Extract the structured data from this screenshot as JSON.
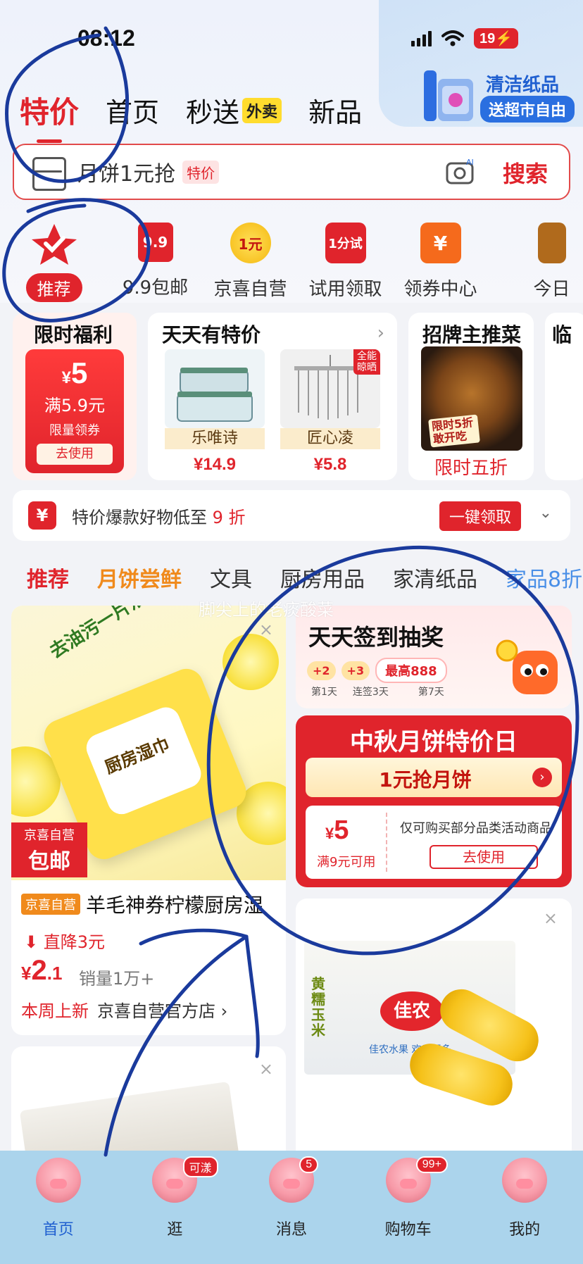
{
  "status_bar": {
    "time": "08:12",
    "battery": "19"
  },
  "promo_corner": {
    "line1": "清洁纸品",
    "line2": "送超市自由"
  },
  "top_tabs": [
    {
      "label": "特价",
      "active": true
    },
    {
      "label": "首页"
    },
    {
      "label": "秒送",
      "badge": "外卖"
    },
    {
      "label": "新品"
    }
  ],
  "search": {
    "query": "月饼1元抢",
    "tag": "特价",
    "button": "搜索"
  },
  "categories": [
    {
      "label": "推荐",
      "active": true,
      "icon": "star-check-icon"
    },
    {
      "label": "9.9包邮",
      "icon": "tag-99-icon",
      "text": "9.9"
    },
    {
      "label": "京喜自营",
      "icon": "coin-1yuan-icon",
      "text": "1元"
    },
    {
      "label": "试用领取",
      "icon": "gift-bag-icon",
      "text": "1分试"
    },
    {
      "label": "领券中心",
      "icon": "coupon-icon",
      "text": "¥"
    },
    {
      "label": "今日",
      "icon": "partial-icon"
    }
  ],
  "cards": {
    "limited": {
      "title": "限时福利",
      "amount": "5",
      "condition": "满5.9元",
      "note": "限量领券",
      "use": "去使用"
    },
    "daily": {
      "title": "天天有特价",
      "products": [
        {
          "name": "乐唯诗",
          "price": "¥14.9"
        },
        {
          "name": "匠心凌",
          "price": "¥5.8",
          "tag": "全能晾晒"
        }
      ]
    },
    "signature": {
      "title": "招牌主推菜",
      "tag": "限时5折 敢开吃",
      "subtitle": "限时五折"
    },
    "partial": {
      "title": "临"
    }
  },
  "coupon_strip": {
    "text": "特价爆款好物低至",
    "highlight": "9 折",
    "button": "一键领取"
  },
  "feed_tabs": [
    "推荐",
    "月饼尝鲜",
    "文具",
    "厨房用品",
    "家清纸品",
    "家品8折"
  ],
  "watermark": "脚尖上的老痰酸菜",
  "feed_left": {
    "slogan": "去油污一片洁净",
    "pack_brand": "厨房湿巾",
    "badge_top": "京喜自营",
    "badge_bottom": "包邮",
    "tag": "京喜自营",
    "title": "羊毛神券柠檬厨房湿",
    "drop": "直降3元",
    "price_int": "2",
    "price_dec": ".1",
    "sales": "销量1万+",
    "new_label": "本周上新",
    "shop": "京喜自营官方店 ›"
  },
  "signin": {
    "title": "天天签到抽奖",
    "pills": [
      "+2",
      "+3",
      "最高888"
    ],
    "days": [
      "第1天",
      "连签3天",
      "第7天"
    ]
  },
  "midautumn": {
    "title": "中秋月饼特价日",
    "cta": "1元抢月饼",
    "coupon_amount": "5",
    "coupon_condition": "满9元可用",
    "coupon_desc": "仅可购买部分品类活动商品",
    "coupon_use": "去使用"
  },
  "corn": {
    "brand": "佳农",
    "side_text": "黄糯玉米",
    "slogan": "佳农水果 欢乐更多"
  },
  "bottom_nav": [
    {
      "label": "首页",
      "active": true
    },
    {
      "label": "逛",
      "badge": "可漾"
    },
    {
      "label": "消息",
      "badge": "5"
    },
    {
      "label": "购物车",
      "badge": "99+"
    },
    {
      "label": "我的"
    }
  ],
  "colors": {
    "brand_red": "#e0242c",
    "nav_bg": "#abd4ec",
    "annotation_blue": "#1a3a9c"
  }
}
